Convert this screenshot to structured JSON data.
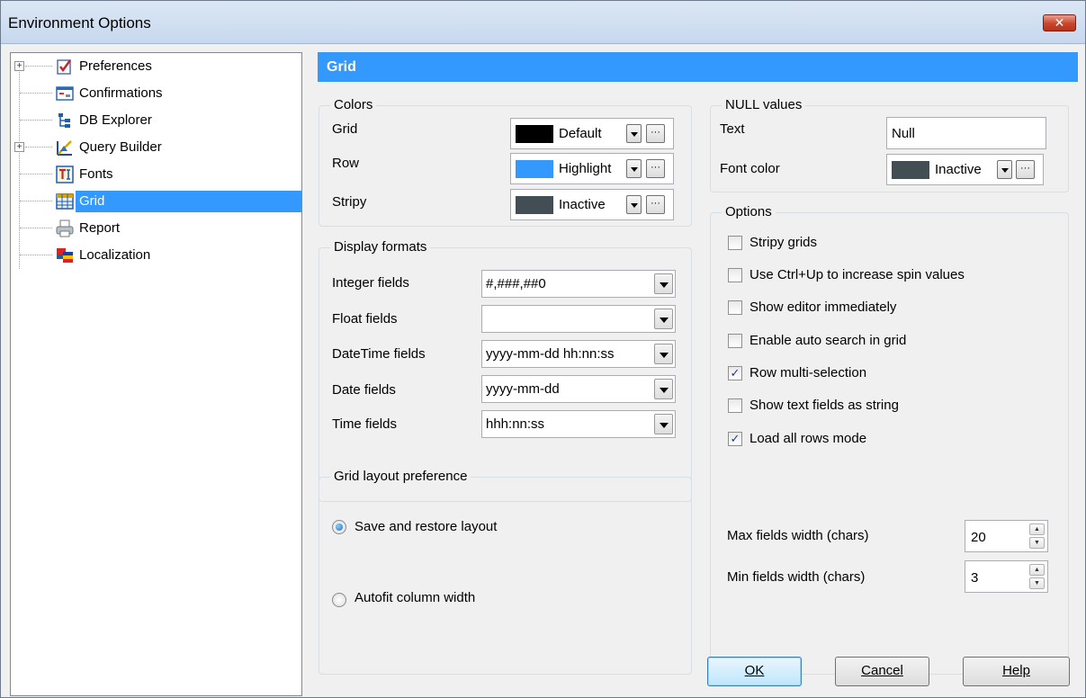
{
  "window": {
    "title": "Environment Options",
    "close_glyph": "✕"
  },
  "tree": {
    "items": [
      {
        "label": "Preferences",
        "icon": "preferences-icon",
        "expandable": true
      },
      {
        "label": "Confirmations",
        "icon": "confirmations-icon",
        "expandable": false
      },
      {
        "label": "DB Explorer",
        "icon": "db-explorer-icon",
        "expandable": false
      },
      {
        "label": "Query Builder",
        "icon": "query-builder-icon",
        "expandable": true
      },
      {
        "label": "Fonts",
        "icon": "fonts-icon",
        "expandable": false
      },
      {
        "label": "Grid",
        "icon": "grid-icon",
        "expandable": false,
        "selected": true
      },
      {
        "label": "Report",
        "icon": "report-icon",
        "expandable": false
      },
      {
        "label": "Localization",
        "icon": "localization-icon",
        "expandable": false
      }
    ],
    "expand_glyph": "+"
  },
  "header": {
    "title": "Grid"
  },
  "colors": {
    "title": "Colors",
    "grid": {
      "label": "Grid",
      "value": "Default",
      "swatch": "#000000"
    },
    "row": {
      "label": "Row",
      "value": "Highlight",
      "swatch": "#3399ff"
    },
    "stripy": {
      "label": "Stripy",
      "value": "Inactive",
      "swatch": "#434e54"
    }
  },
  "null_values": {
    "title": "NULL values",
    "text_label": "Text",
    "text_value": "Null",
    "font_color_label": "Font color",
    "font_color_value": "Inactive",
    "font_color_swatch": "#434e54"
  },
  "display_formats": {
    "title": "Display formats",
    "rows": [
      {
        "label": "Integer fields",
        "value": "#,###,##0"
      },
      {
        "label": "Float fields",
        "value": ""
      },
      {
        "label": "DateTime fields",
        "value": "yyyy-mm-dd hh:nn:ss"
      },
      {
        "label": "Date fields",
        "value": "yyyy-mm-dd"
      },
      {
        "label": "Time fields",
        "value": "hhh:nn:ss"
      }
    ]
  },
  "grid_layout": {
    "title": "Grid layout preference",
    "options": [
      {
        "label": "Save and restore layout",
        "selected": true
      },
      {
        "label": "Autofit column width",
        "selected": false
      }
    ]
  },
  "options": {
    "title": "Options",
    "checkboxes": [
      {
        "label": "Stripy grids",
        "checked": false
      },
      {
        "label": "Use Ctrl+Up to increase spin values",
        "checked": false
      },
      {
        "label": "Show editor immediately",
        "checked": false
      },
      {
        "label": "Enable auto search in grid",
        "checked": false
      },
      {
        "label": "Row multi-selection",
        "checked": true
      },
      {
        "label": "Show text fields as string",
        "checked": false
      },
      {
        "label": "Load all rows mode",
        "checked": true
      }
    ],
    "check_glyph": "✓",
    "max_width_label": "Max fields width (chars)",
    "max_width_value": "20",
    "min_width_label": "Min fields width (chars)",
    "min_width_value": "3"
  },
  "buttons": {
    "ok": "OK",
    "cancel": "Cancel",
    "help": "Help"
  },
  "glyphs": {
    "ellipsis": "···",
    "spin_up": "▲",
    "spin_down": "▼"
  }
}
